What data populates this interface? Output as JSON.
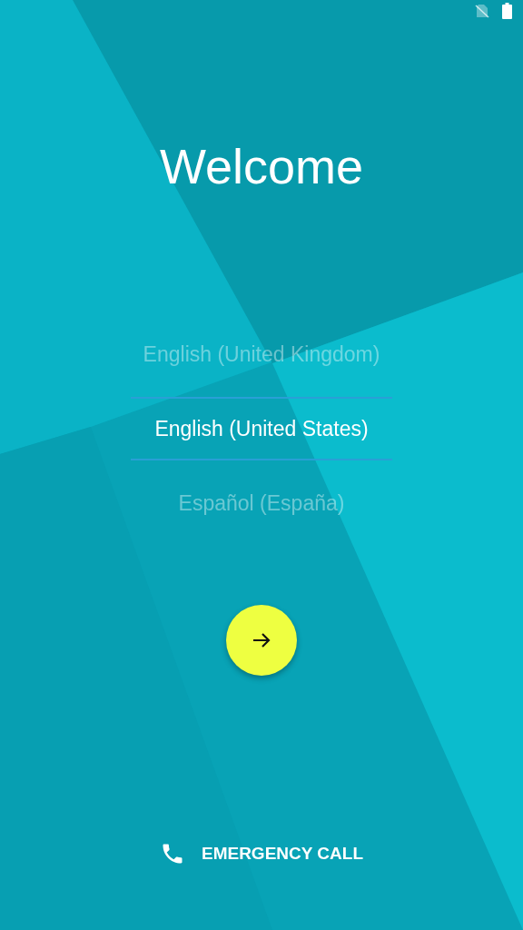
{
  "title": "Welcome",
  "languages": [
    {
      "label": "English (United Kingdom)",
      "selected": false
    },
    {
      "label": "English (United States)",
      "selected": true
    },
    {
      "label": "Español (España)",
      "selected": false
    }
  ],
  "emergency_call": {
    "label": "EMERGENCY CALL"
  }
}
